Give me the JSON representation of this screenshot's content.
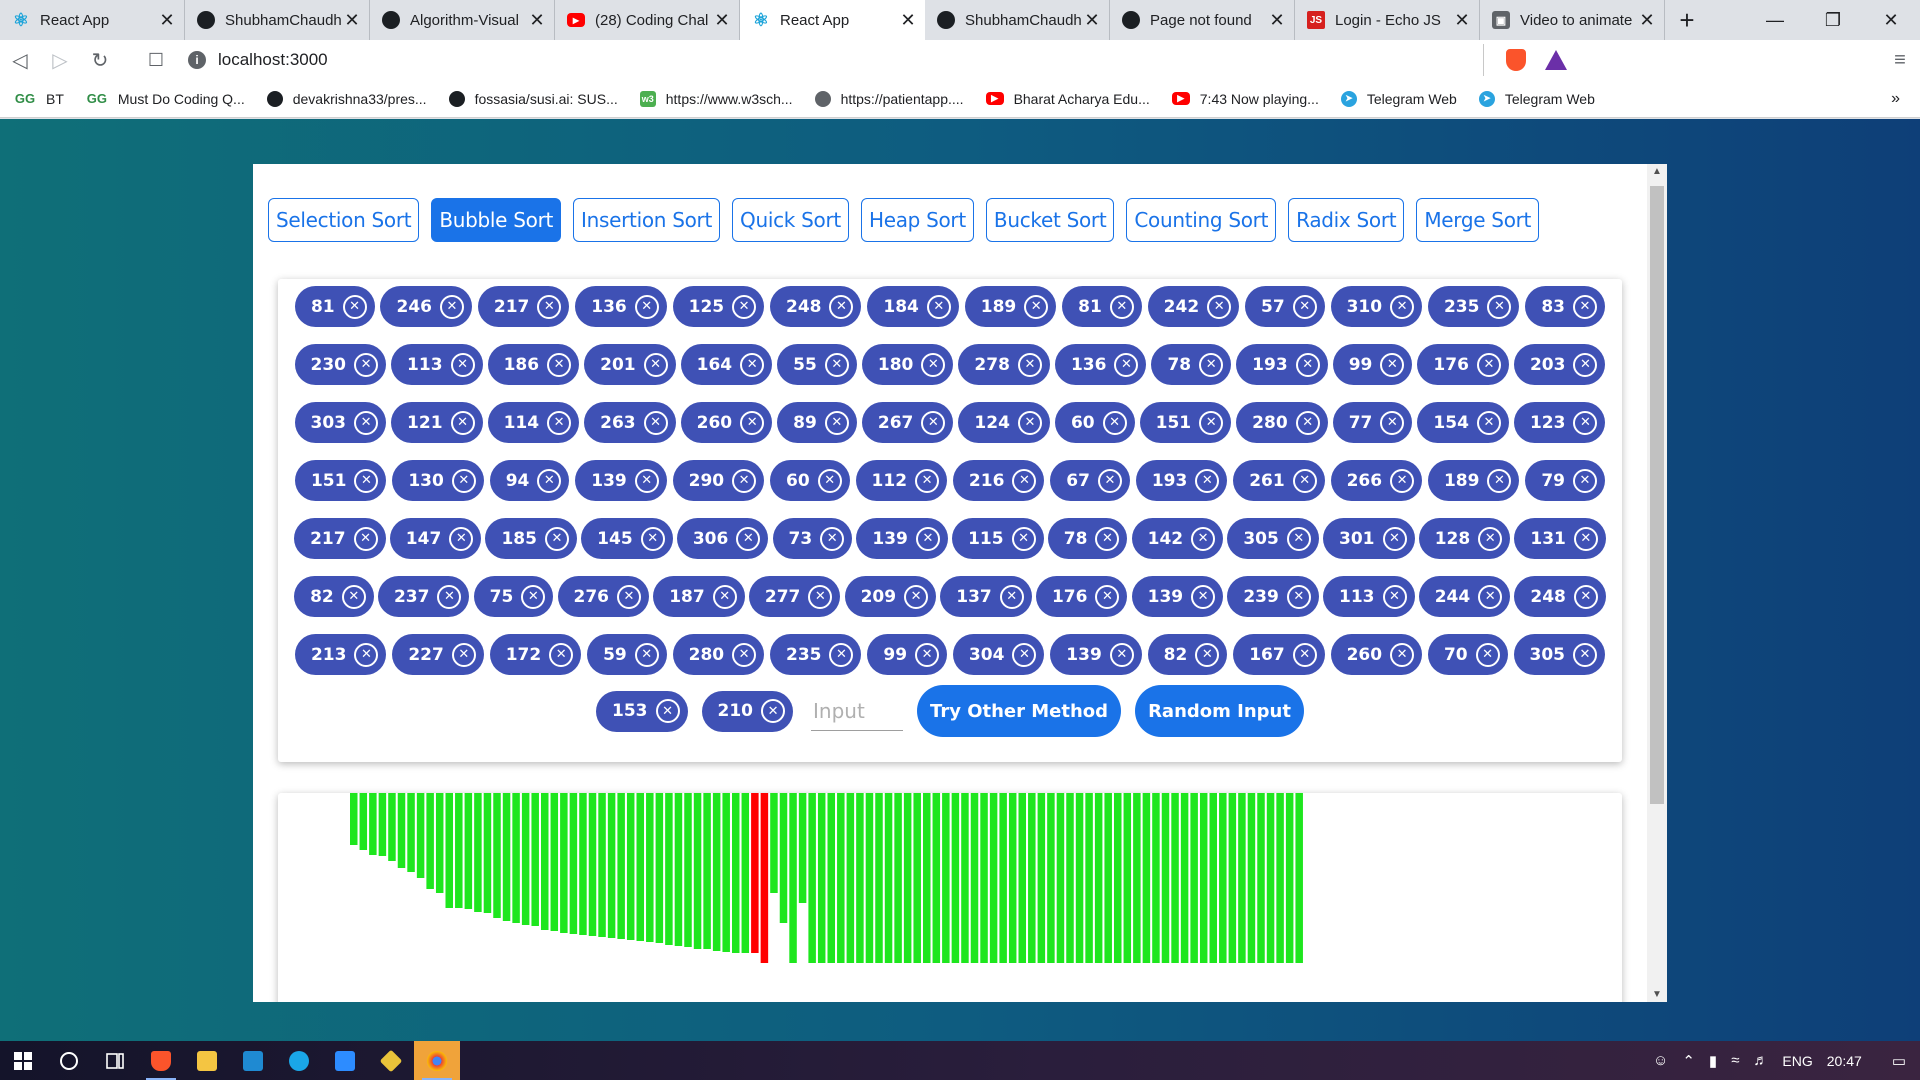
{
  "browser": {
    "tabs": [
      {
        "title": "React App",
        "icon": "react-icon",
        "active": false
      },
      {
        "title": "ShubhamChaudh",
        "icon": "github-icon",
        "active": false
      },
      {
        "title": "Algorithm-Visual",
        "icon": "github-icon",
        "active": false
      },
      {
        "title": "(28) Coding Chal",
        "icon": "youtube-icon",
        "active": false
      },
      {
        "title": "React App",
        "icon": "react-icon",
        "active": true
      },
      {
        "title": "ShubhamChaudh",
        "icon": "github-icon",
        "active": false
      },
      {
        "title": "Page not found",
        "icon": "github-icon",
        "active": false
      },
      {
        "title": "Login - Echo JS",
        "icon": "echojs-icon",
        "active": false
      },
      {
        "title": "Video to animate",
        "icon": "video-icon",
        "active": false
      }
    ],
    "url": "localhost:3000",
    "bookmarks": [
      {
        "label": "BT",
        "icon": "gfg-icon"
      },
      {
        "label": "Must Do Coding Q...",
        "icon": "gfg-icon"
      },
      {
        "label": "devakrishna33/pres...",
        "icon": "github-icon"
      },
      {
        "label": "fossasia/susi.ai: SUS...",
        "icon": "github-icon"
      },
      {
        "label": "https://www.w3sch...",
        "icon": "w3schools-icon"
      },
      {
        "label": "https://patientapp....",
        "icon": "globe-icon"
      },
      {
        "label": "Bharat Acharya Edu...",
        "icon": "youtube-icon"
      },
      {
        "label": "7:43 Now playing...",
        "icon": "youtube-icon"
      },
      {
        "label": "Telegram Web",
        "icon": "telegram-icon"
      },
      {
        "label": "Telegram Web",
        "icon": "telegram-icon"
      }
    ]
  },
  "app": {
    "algorithms": [
      {
        "label": "Selection Sort",
        "selected": false
      },
      {
        "label": "Bubble Sort",
        "selected": true
      },
      {
        "label": "Insertion Sort",
        "selected": false
      },
      {
        "label": "Quick Sort",
        "selected": false
      },
      {
        "label": "Heap Sort",
        "selected": false
      },
      {
        "label": "Bucket Sort",
        "selected": false
      },
      {
        "label": "Counting Sort",
        "selected": false
      },
      {
        "label": "Radix Sort",
        "selected": false
      },
      {
        "label": "Merge Sort",
        "selected": false
      }
    ],
    "chip_rows": [
      [
        81,
        246,
        217,
        136,
        125,
        248,
        184,
        189,
        81,
        242,
        57,
        310,
        235,
        83
      ],
      [
        230,
        113,
        186,
        201,
        164,
        55,
        180,
        278,
        136,
        78,
        193,
        99,
        176,
        203
      ],
      [
        303,
        121,
        114,
        263,
        260,
        89,
        267,
        124,
        60,
        151,
        280,
        77,
        154,
        123
      ],
      [
        151,
        130,
        94,
        139,
        290,
        60,
        112,
        216,
        67,
        193,
        261,
        266,
        189,
        79
      ],
      [
        217,
        147,
        185,
        145,
        306,
        73,
        139,
        115,
        78,
        142,
        305,
        301,
        128,
        131
      ],
      [
        82,
        237,
        75,
        276,
        187,
        277,
        209,
        137,
        176,
        139,
        239,
        113,
        244,
        248
      ],
      [
        213,
        227,
        172,
        59,
        280,
        235,
        99,
        304,
        139,
        82,
        167,
        260,
        70,
        305
      ],
      [
        153,
        210
      ]
    ],
    "input_placeholder": "Input",
    "try_other_label": "Try Other Method",
    "random_input_label": "Random Input",
    "colors": {
      "primary": "#1a73e8",
      "chip": "#3f51b5",
      "bar_default": "#1ee61e",
      "bar_compare": "#ff0000"
    }
  },
  "chart_data": {
    "type": "bar",
    "bar_count": 100,
    "highlighted_indices": [
      42,
      43
    ],
    "bar_bottoms_visible": [
      52,
      57,
      62,
      63,
      68,
      75,
      79,
      85,
      96,
      100,
      115,
      115,
      116,
      119,
      120,
      125,
      128,
      130,
      132,
      133,
      137,
      138,
      140,
      141,
      142,
      143,
      144,
      145,
      146,
      147,
      148,
      149,
      150,
      152,
      153,
      154,
      156,
      156,
      158,
      159,
      160,
      160,
      160,
      170,
      100,
      130,
      170,
      110,
      170,
      170,
      170,
      170,
      170,
      170,
      170,
      170,
      170,
      170,
      170,
      170,
      170,
      170,
      170,
      170,
      170,
      170,
      170,
      170,
      170,
      170,
      170,
      170,
      170,
      170,
      170,
      170,
      170,
      170,
      170,
      170,
      170,
      170,
      170,
      170,
      170,
      170,
      170,
      170,
      170,
      170,
      170,
      170,
      170,
      170,
      170,
      170,
      170,
      170,
      170,
      170
    ]
  },
  "taskbar": {
    "language": "ENG",
    "time": "20:47"
  }
}
